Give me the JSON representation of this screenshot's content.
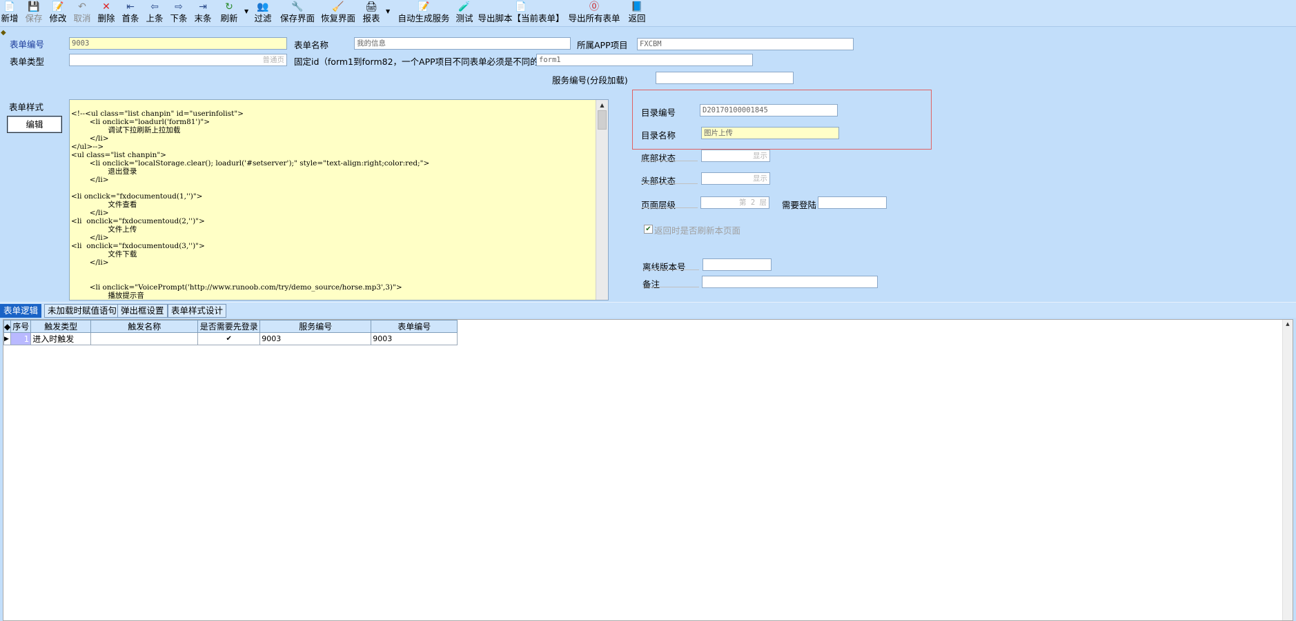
{
  "toolbar": {
    "items": [
      {
        "label": "新增",
        "icon": "📄"
      },
      {
        "label": "保存",
        "icon": "💾"
      },
      {
        "label": "修改",
        "icon": "📝"
      },
      {
        "label": "取消",
        "icon": "↶"
      },
      {
        "label": "删除",
        "icon": "✕"
      },
      {
        "label": "首条",
        "icon": "⇤"
      },
      {
        "label": "上条",
        "icon": "⇦"
      },
      {
        "label": "下条",
        "icon": "⇨"
      },
      {
        "label": "末条",
        "icon": "⇥"
      },
      {
        "label": "刷新",
        "icon": "↻"
      },
      {
        "label": "过滤",
        "icon": "👥"
      },
      {
        "label": "保存界面",
        "icon": "🔧"
      },
      {
        "label": "恢复界面",
        "icon": "🧹"
      },
      {
        "label": "报表",
        "icon": "🖨"
      },
      {
        "label": "自动生成服务",
        "icon": "📝"
      },
      {
        "label": "测试",
        "icon": "🧪"
      },
      {
        "label": "导出脚本【当前表单】",
        "icon": "📄"
      },
      {
        "label": "导出所有表单",
        "icon": "⓪"
      },
      {
        "label": "返回",
        "icon": "📘"
      }
    ]
  },
  "form": {
    "form_no_label": "表单编号",
    "form_no_value": "9003",
    "form_name_label": "表单名称",
    "form_name_value": "我的信息",
    "app_label": "所属APP项目",
    "app_value": "FXCBM",
    "form_type_label": "表单类型",
    "form_type_value": "普通页",
    "fixed_id_label": "固定id（form1到form82，一个APP项目不同表单必须是不同的id）",
    "fixed_id_value": "form1",
    "service_no_label": "服务编号(分段加载)",
    "service_no_value": "",
    "style_label": "表单样式",
    "edit_button": "编辑",
    "code": "<!--<ul class=\"list chanpin\" id=\"userinfolist\">\n        <li onclick=\"loadurl('form81')\">\n                调试下拉刷新上拉加载\n        </li>\n</ul>-->\n<ul class=\"list chanpin\">\n        <li onclick=\"localStorage.clear(); loadurl('#setserver');\" style=\"text-align:right;color:red;\">\n                退出登录\n        </li>\n\n<li onclick=\"fxdocumentoud(1,'')\">\n                文件查看\n        </li>\n<li  onclick=\"fxdocumentoud(2,'')\">\n                文件上传\n        </li>\n<li  onclick=\"fxdocumentoud(3,'')\">\n                文件下载\n        </li>\n\n\n        <li onclick=\"VoicePrompt('http://www.runoob.com/try/demo_source/horse.mp3',3)\">\n                播放提示音",
    "dir_no_label": "目录编号",
    "dir_no_value": "D20170100001845",
    "dir_name_label": "目录名称",
    "dir_name_value": "图片上传",
    "bottom_status_label": "底部状态",
    "bottom_status_value": "显示",
    "top_status_label": "头部状态",
    "top_status_value": "显示",
    "page_level_label": "页面层级",
    "page_level_value": "第 2 层",
    "need_login_label": "需要登陆",
    "need_login_value": "",
    "refresh_on_return_label": "返回时是否刷新本页面",
    "offline_version_label": "离线版本号",
    "offline_version_value": "",
    "remark_label": "备注",
    "remark_value": ""
  },
  "tabs": [
    {
      "label": "表单逻辑"
    },
    {
      "label": "未加载时赋值语句"
    },
    {
      "label": "弹出框设置"
    },
    {
      "label": "表单样式设计"
    }
  ],
  "grid": {
    "columns": [
      "序号",
      "触发类型",
      "触发名称",
      "是否需要先登录",
      "服务编号",
      "表单编号"
    ],
    "rows": [
      {
        "seq": "1",
        "trigger_type": "进入时触发",
        "trigger_name": "",
        "need_login": "✔",
        "service_no": "9003",
        "form_no": "9003"
      }
    ]
  }
}
